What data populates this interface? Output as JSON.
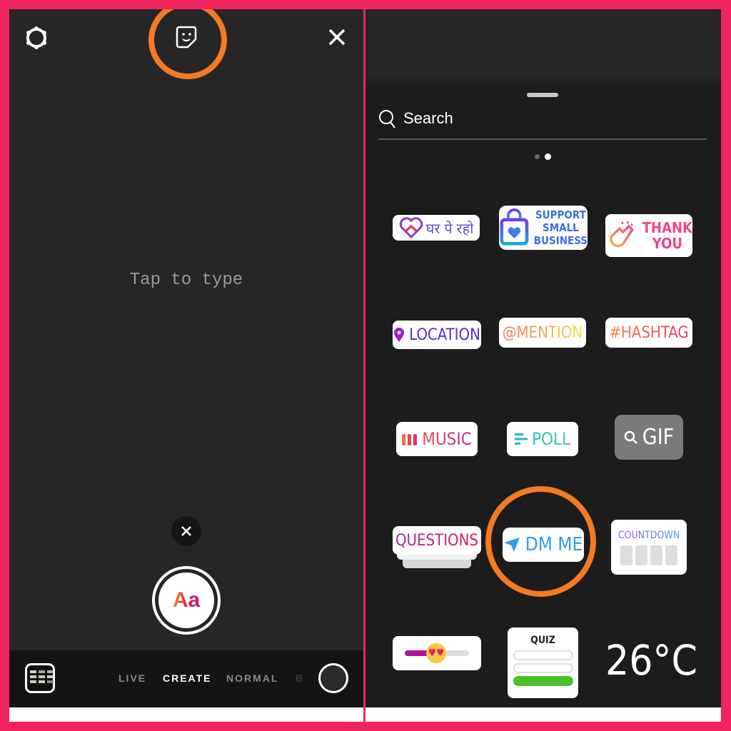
{
  "left": {
    "placeholder": "Tap to type",
    "text_button": "Aa",
    "modes": [
      "LIVE",
      "CREATE",
      "NORMAL",
      "B"
    ],
    "active_mode": "CREATE",
    "icons": [
      "settings-icon",
      "sticker-icon",
      "close-icon",
      "dismiss-icon",
      "gallery-icon",
      "capture-button"
    ]
  },
  "right": {
    "search_placeholder": "Search",
    "page_dots": 2,
    "active_page": 2,
    "stickers": {
      "ghar": "घर पे रहो",
      "support": [
        "SUPPORT",
        "SMALL",
        "BUSINESS"
      ],
      "thank": [
        "THANK",
        "YOU"
      ],
      "location": "LOCATION",
      "mention": "@MENTION",
      "hashtag": "#HASHTAG",
      "music": "MUSIC",
      "poll": "POLL",
      "gif": "GIF",
      "questions": "QUESTIONS",
      "dm": "DM ME",
      "countdown": "COUNTDOWN",
      "quiz": "QUIZ",
      "weather": "26°C"
    }
  },
  "colors": {
    "border": "#f0245f",
    "highlight": "#f47b20",
    "panel": "#262626"
  }
}
